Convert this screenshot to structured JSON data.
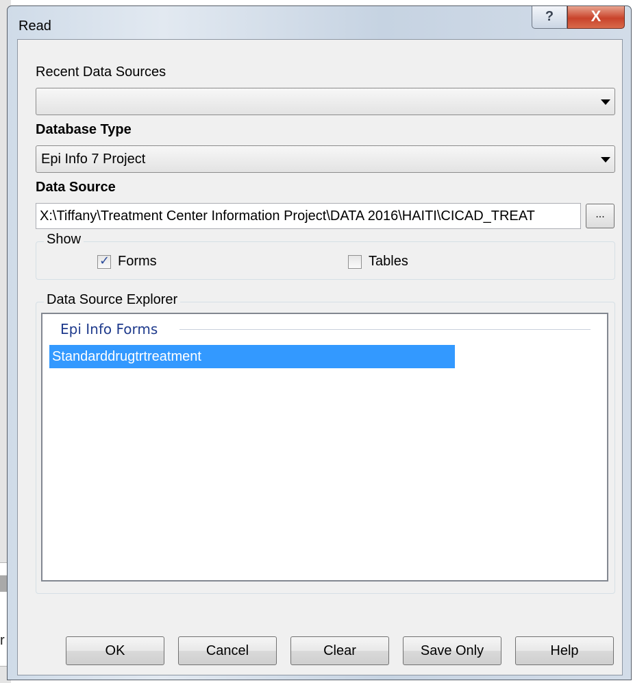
{
  "dialog": {
    "title": "Read",
    "help_glyph": "?",
    "close_glyph": "X"
  },
  "background": {
    "partial_text": "r"
  },
  "recent_sources": {
    "label": "Recent Data Sources",
    "value": ""
  },
  "database_type": {
    "label": "Database Type",
    "value": "Epi Info 7 Project"
  },
  "data_source": {
    "label": "Data Source",
    "value": "X:\\Tiffany\\Treatment Center Information Project\\DATA 2016\\HAITI\\CICAD_TREAT",
    "browse_label": "..."
  },
  "show": {
    "title": "Show",
    "forms_label": "Forms",
    "forms_checked": true,
    "tables_label": "Tables",
    "tables_checked": false
  },
  "explorer": {
    "title": "Data Source Explorer",
    "section_header": "Epi Info Forms",
    "items": [
      "Standarddrugtrtreatment"
    ],
    "selected_index": 0
  },
  "buttons": {
    "ok": "OK",
    "cancel": "Cancel",
    "clear": "Clear",
    "save_only": "Save Only",
    "help": "Help"
  }
}
